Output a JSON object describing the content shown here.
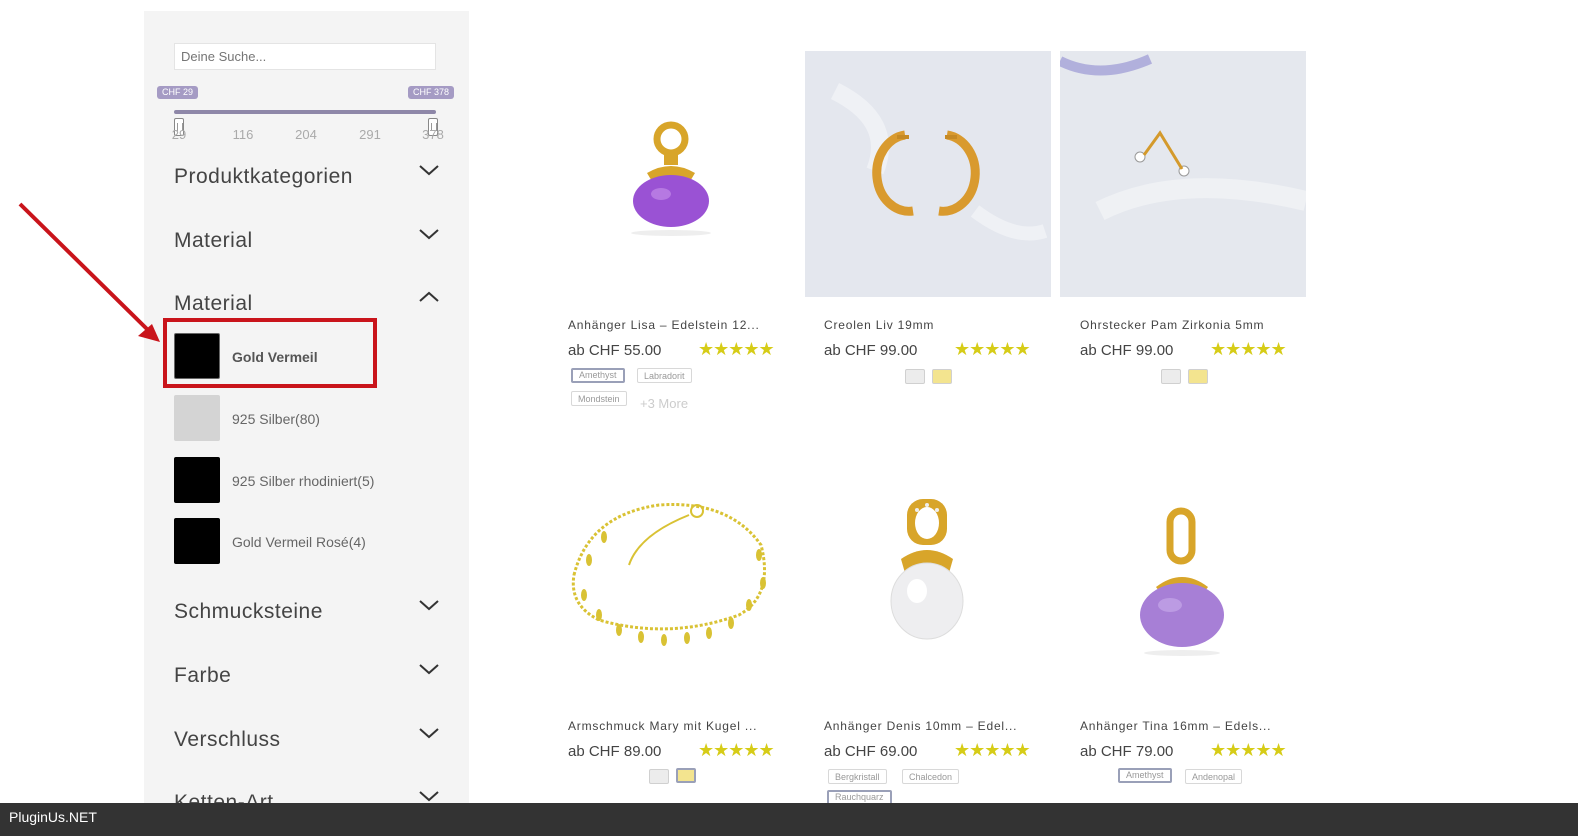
{
  "sidebar": {
    "search_placeholder": "Deine Suche...",
    "price_min": "CHF 29",
    "price_max": "CHF 378",
    "ticks": [
      "29",
      "116",
      "204",
      "291",
      "378"
    ],
    "facets": {
      "produktkategorien": "Produktkategorien",
      "material_collapsed": "Material",
      "material_open": "Material",
      "schmucksteine": "Schmucksteine",
      "farbe": "Farbe",
      "verschluss": "Verschluss",
      "ketten_art": "Ketten-Art"
    },
    "material_options": [
      {
        "label": "Gold Vermeil",
        "swatch": "#000000",
        "selected": true
      },
      {
        "label": "925 Silber(80)",
        "swatch": "#d4d4d4",
        "selected": false
      },
      {
        "label": "925 Silber rhodiniert(5)",
        "swatch": "#000000",
        "selected": false
      },
      {
        "label": "Gold Vermeil Rosé(4)",
        "swatch": "#000000",
        "selected": false
      }
    ]
  },
  "products": [
    {
      "name": "Anhänger Lisa – Edelstein 12...",
      "price": "ab CHF 55.00",
      "rating": 5,
      "tags": [
        "Amethyst",
        "Labradorit",
        "Mondstein"
      ],
      "more": "+3 More"
    },
    {
      "name": "Creolen Liv 19mm",
      "price": "ab CHF 99.00",
      "rating": 5,
      "colors": [
        "#ececec",
        "#f3e48f"
      ]
    },
    {
      "name": "Ohrstecker Pam Zirkonia 5mm",
      "price": "ab CHF 99.00",
      "rating": 5,
      "colors": [
        "#ececec",
        "#f3e48f"
      ]
    },
    {
      "name": "Armschmuck Mary mit Kugel ...",
      "price": "ab CHF 89.00",
      "rating": 5,
      "colors": [
        "#ececec",
        "#f3e48f"
      ]
    },
    {
      "name": "Anhänger Denis 10mm – Edel...",
      "price": "ab CHF 69.00",
      "rating": 5,
      "tags": [
        "Bergkristall",
        "Chalcedon",
        "Rauchquarz"
      ]
    },
    {
      "name": "Anhänger Tina 16mm – Edels...",
      "price": "ab CHF 79.00",
      "rating": 5,
      "tags": [
        "Amethyst",
        "Andenopal"
      ]
    }
  ],
  "stars": "★★★★★",
  "annotation": {
    "color": "#c9141b"
  },
  "footer": {
    "text": "PluginUs.NET"
  }
}
